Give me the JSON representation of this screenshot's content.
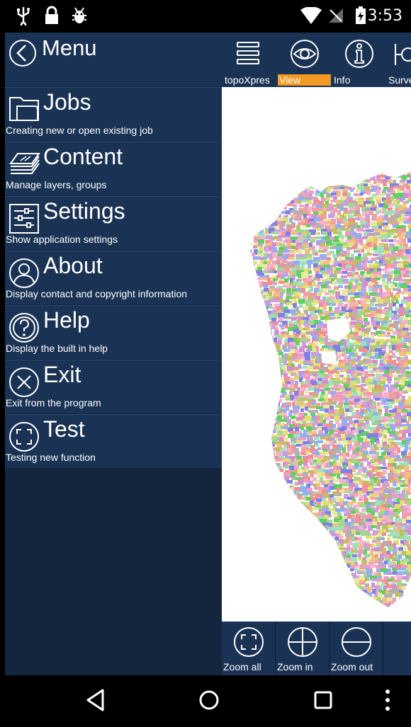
{
  "status": {
    "time": "3:53"
  },
  "menu": {
    "title": "Menu",
    "items": [
      {
        "icon": "folder-icon",
        "label": "Jobs",
        "description": "Creating new or open existing job"
      },
      {
        "icon": "layers-icon",
        "label": "Content",
        "description": "Manage layers, groups"
      },
      {
        "icon": "sliders-icon",
        "label": "Settings",
        "description": "Show application settings"
      },
      {
        "icon": "person-icon",
        "label": "About",
        "description": "Display contact and copyright information"
      },
      {
        "icon": "question-icon",
        "label": "Help",
        "description": "Display the built in help"
      },
      {
        "icon": "close-circle-icon",
        "label": "Exit",
        "description": "Exit from the program"
      },
      {
        "icon": "frame-icon",
        "label": "Test",
        "description": "Testing new function"
      }
    ]
  },
  "toolbar": {
    "items": [
      {
        "icon": "hamburger-icon",
        "label": "topoXpres"
      },
      {
        "icon": "eye-icon",
        "label": "View",
        "active": true
      },
      {
        "icon": "info-icon",
        "label": "Info"
      },
      {
        "icon": "survey-icon",
        "label": "Surve"
      }
    ],
    "active_color": "#f49a22"
  },
  "zoom": {
    "items": [
      {
        "icon": "zoom-all-icon",
        "label": "Zoom all"
      },
      {
        "icon": "zoom-in-icon",
        "label": "Zoom in"
      },
      {
        "icon": "zoom-out-icon",
        "label": "Zoom out"
      }
    ]
  },
  "colors": {
    "panel": "#1a3354",
    "panel_dark": "#14263e",
    "accent": "#f49a22"
  }
}
